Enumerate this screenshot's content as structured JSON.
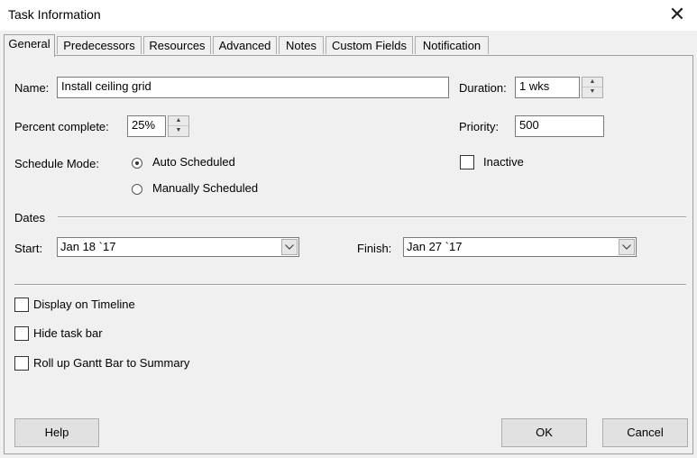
{
  "window": {
    "title": "Task Information",
    "close_glyph": "✕"
  },
  "tabs": [
    "General",
    "Predecessors",
    "Resources",
    "Advanced",
    "Notes",
    "Custom Fields",
    "Notification"
  ],
  "form": {
    "name_label": "Name:",
    "name_value": "Install ceiling grid",
    "duration_label": "Duration:",
    "duration_value": "1 wks",
    "percent_label": "Percent complete:",
    "percent_value": "25%",
    "priority_label": "Priority:",
    "priority_value": "500",
    "schedule_mode_label": "Schedule Mode:",
    "auto_label": "Auto Scheduled",
    "manual_label": "Manually Scheduled",
    "inactive_label": "Inactive"
  },
  "dates": {
    "section_label": "Dates",
    "start_label": "Start:",
    "start_value": "Jan 18 `17",
    "finish_label": "Finish:",
    "finish_value": "Jan 27 `17"
  },
  "options": {
    "display_timeline": "Display on Timeline",
    "hide_taskbar": "Hide task bar",
    "rollup": "Roll up Gantt Bar to Summary"
  },
  "buttons": {
    "help": "Help",
    "ok": "OK",
    "cancel": "Cancel"
  }
}
